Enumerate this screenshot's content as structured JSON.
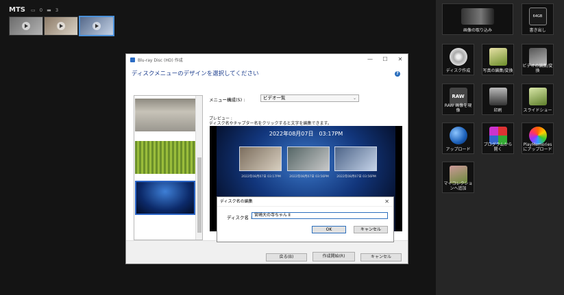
{
  "browser": {
    "folder_title": "MTS",
    "photo_count": "0",
    "video_count": "3",
    "thumbnails": [
      {
        "colors": [
          "#6c6c6c",
          "#b3b3b3"
        ]
      },
      {
        "colors": [
          "#8d7b68",
          "#d9d2c5"
        ]
      },
      {
        "colors": [
          "#55698a",
          "#c4d2e6"
        ]
      }
    ]
  },
  "panel": {
    "tiles": [
      {
        "label": "画像の取り込み",
        "icon": "camera-icon"
      },
      {
        "label": "書き出し",
        "icon": "sd-card-icon",
        "badge": "64GB"
      },
      {
        "label": "ディスク作成",
        "icon": "disc-icon"
      },
      {
        "label": "写真の編集/変換",
        "icon": "photo-edit-icon"
      },
      {
        "label": "ビデオの編集/変換",
        "icon": "video-edit-icon"
      },
      {
        "label": "RAW 画像を現像",
        "icon": "raw-icon",
        "badge": "RAW"
      },
      {
        "label": "印刷",
        "icon": "printer-icon"
      },
      {
        "label": "スライドショー",
        "icon": "slideshow-icon"
      },
      {
        "label": "アップロード",
        "icon": "globe-icon"
      },
      {
        "label": "プログラムから 開く",
        "icon": "apps-icon"
      },
      {
        "label": "PlayMemories にアップロード",
        "icon": "playmemories-icon"
      },
      {
        "label": "マイコレクショ ンへ追加",
        "icon": "collection-icon"
      }
    ]
  },
  "wizard": {
    "title": "Blu-ray Disc (HD) 作成",
    "heading": "ディスクメニューのデザインを選択してください",
    "menu_label": "メニュー構成(S) :",
    "menu_value": "ビデオ一覧",
    "preview_label": "プレビュー :",
    "preview_hint": "ディスク名やチャプター名をクリックすると文字を編集できます。",
    "preview_datetime": "2022年08月07日　03:17PM",
    "chapter_captions": [
      "2022年08月07日 03:17PM",
      "2022年08月07日 03:56PM",
      "2022年08月07日 03:56PM"
    ],
    "back_button": "戻る(B)",
    "start_button": "作成開始(R)",
    "cancel_button": "キャンセル"
  },
  "dialog": {
    "title": "ディスク名の編集",
    "label": "ディスク名 :",
    "value": "宮崎大の寺ちゃん Ⅱ",
    "ok_button": "OK",
    "cancel_button": "キャンセル"
  }
}
